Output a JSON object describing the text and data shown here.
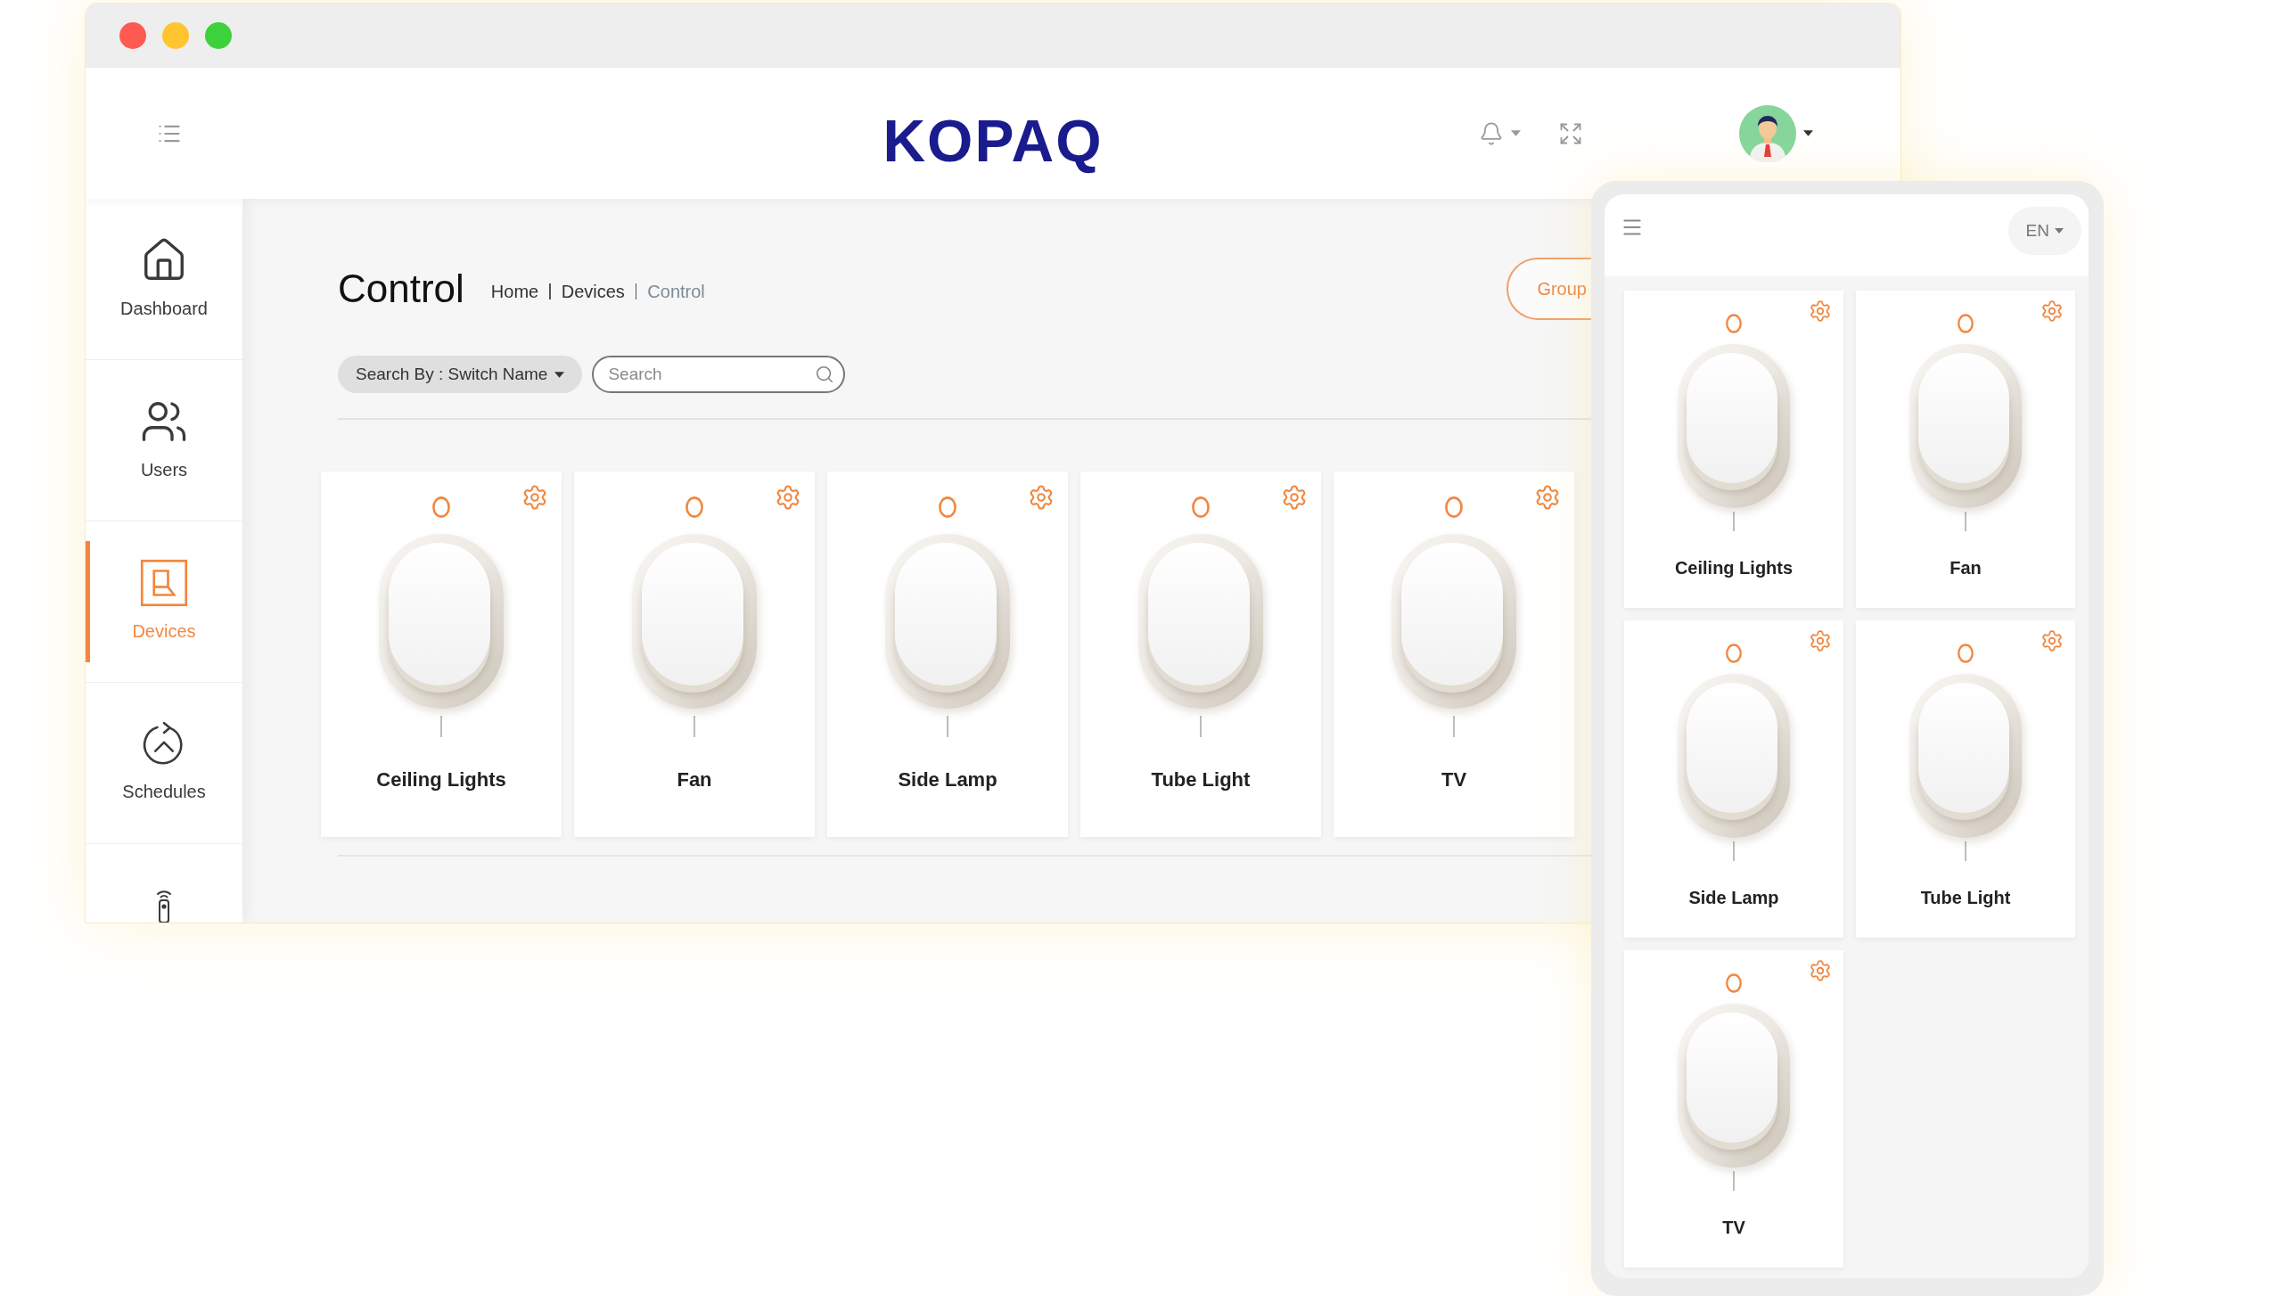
{
  "window": {
    "buttons": [
      {
        "color": "#ff5a52"
      },
      {
        "color": "#ffc52f"
      },
      {
        "color": "#3dd13b"
      }
    ]
  },
  "header": {
    "logo": "KOPAQ"
  },
  "sidebar": {
    "items": [
      {
        "label": "Dashboard",
        "selected": false
      },
      {
        "label": "Users",
        "selected": false
      },
      {
        "label": "Devices",
        "selected": true
      },
      {
        "label": "Schedules",
        "selected": false
      },
      {
        "selected": false
      }
    ]
  },
  "page": {
    "title": "Control",
    "breadcrumb": [
      {
        "label": "Home",
        "selected": false
      },
      {
        "label": "Devices",
        "selected": false
      },
      {
        "label": "Control",
        "selected": true
      }
    ],
    "group_button": "Group",
    "search_by": {
      "label": "Search By : Switch Name"
    },
    "search": {
      "placeholder": "Search"
    },
    "switches": [
      {
        "name": "Ceiling Lights",
        "on": false
      },
      {
        "name": "Fan",
        "on": false
      },
      {
        "name": "Side Lamp",
        "on": false
      },
      {
        "name": "Tube Light",
        "on": false
      },
      {
        "name": "TV",
        "on": false
      }
    ]
  },
  "mobile": {
    "language": "EN",
    "switches": [
      {
        "name": "Ceiling Lights",
        "on": false
      },
      {
        "name": "Fan",
        "on": false
      },
      {
        "name": "Side Lamp",
        "on": false
      },
      {
        "name": "Tube Light",
        "on": false
      },
      {
        "name": "TV",
        "on": false
      }
    ]
  }
}
